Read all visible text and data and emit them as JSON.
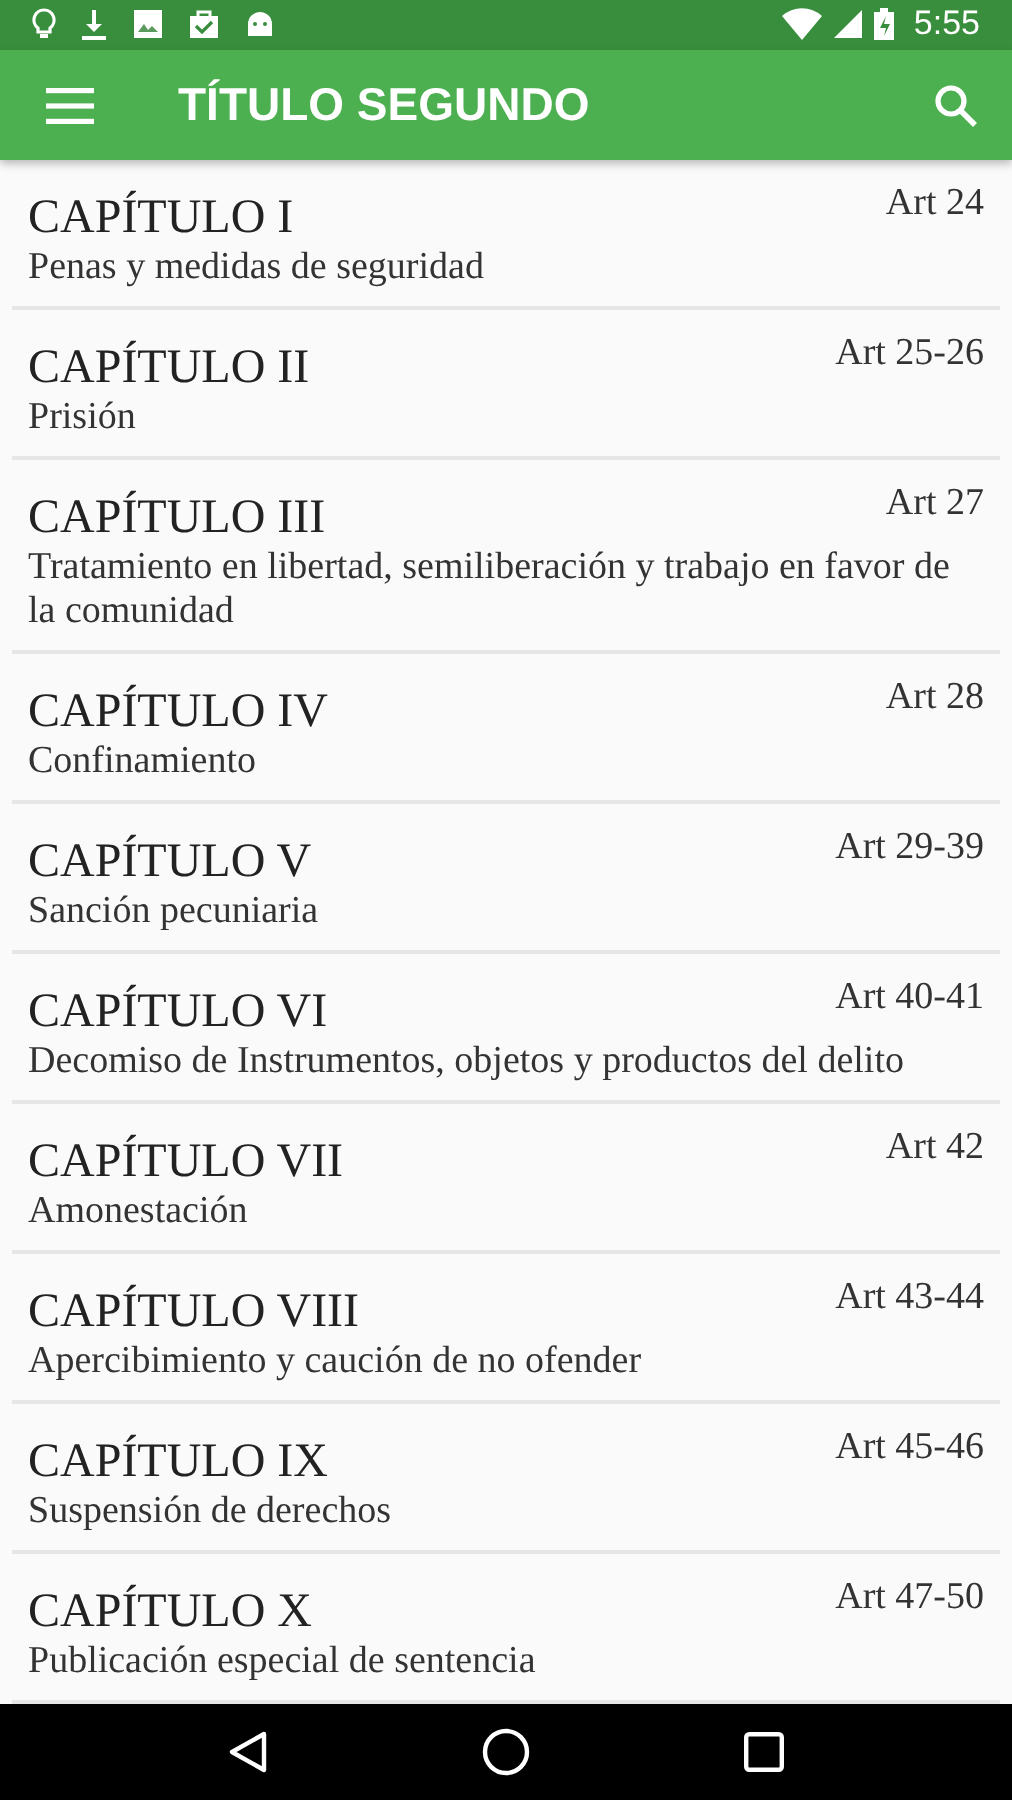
{
  "status_bar": {
    "time": "5:55"
  },
  "app_bar": {
    "title": "TÍTULO SEGUNDO"
  },
  "chapters": [
    {
      "title": "CAPÍTULO I",
      "articles": "Art 24",
      "subtitle": "Penas y medidas de seguridad"
    },
    {
      "title": "CAPÍTULO II",
      "articles": "Art 25-26",
      "subtitle": "Prisión"
    },
    {
      "title": "CAPÍTULO III",
      "articles": "Art 27",
      "subtitle": "Tratamiento en libertad, semiliberación y trabajo en favor de la comunidad"
    },
    {
      "title": "CAPÍTULO IV",
      "articles": "Art 28",
      "subtitle": "Confinamiento"
    },
    {
      "title": "CAPÍTULO V",
      "articles": "Art 29-39",
      "subtitle": "Sanción pecuniaria"
    },
    {
      "title": "CAPÍTULO VI",
      "articles": "Art 40-41",
      "subtitle": "Decomiso de Instrumentos, objetos y productos del delito"
    },
    {
      "title": "CAPÍTULO VII",
      "articles": "Art 42",
      "subtitle": "Amonestación"
    },
    {
      "title": "CAPÍTULO VIII",
      "articles": "Art 43-44",
      "subtitle": "Apercibimiento y caución de no ofender"
    },
    {
      "title": "CAPÍTULO IX",
      "articles": "Art 45-46",
      "subtitle": "Suspensión de derechos"
    },
    {
      "title": "CAPÍTULO X",
      "articles": "Art 47-50",
      "subtitle": "Publicación especial de sentencia"
    }
  ]
}
